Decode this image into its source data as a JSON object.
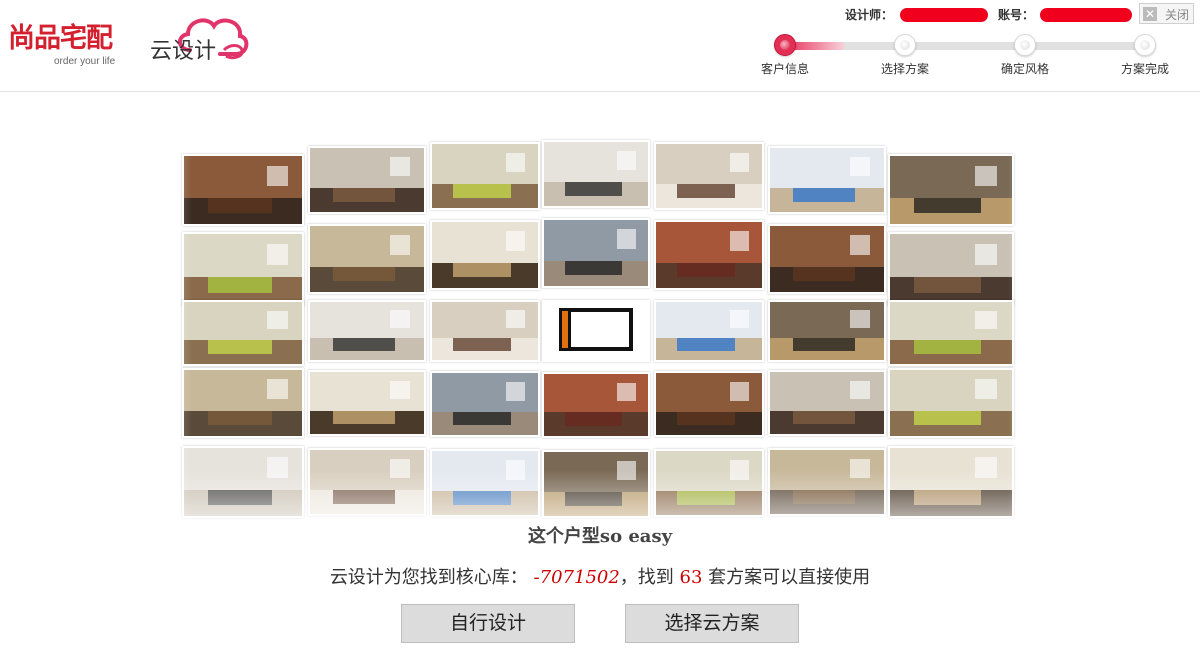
{
  "header": {
    "brand_name": "尚品宅配",
    "brand_tagline": "order your life",
    "product_name": "云设计",
    "designer_label": "设计师：",
    "account_label": "账号：",
    "close_label": "关闭",
    "close_icon": "x-icon"
  },
  "steps": [
    {
      "label": "客户信息",
      "active": true
    },
    {
      "label": "选择方案",
      "active": false
    },
    {
      "label": "确定风格",
      "active": false
    },
    {
      "label": "方案完成",
      "active": false
    }
  ],
  "main": {
    "headline": "这个户型so easy",
    "found_prefix": "云设计为您找到核心库：",
    "library_code": "-7071502",
    "found_middle": "，找到",
    "scheme_count": "63",
    "found_suffix": "套方案可以直接使用"
  },
  "actions": {
    "self_design_label": "自行设计",
    "cloud_scheme_label": "选择云方案"
  },
  "colors": {
    "brand_red": "#d4202f",
    "accent_pink": "#e23055",
    "highlight_red": "#cc0000"
  }
}
